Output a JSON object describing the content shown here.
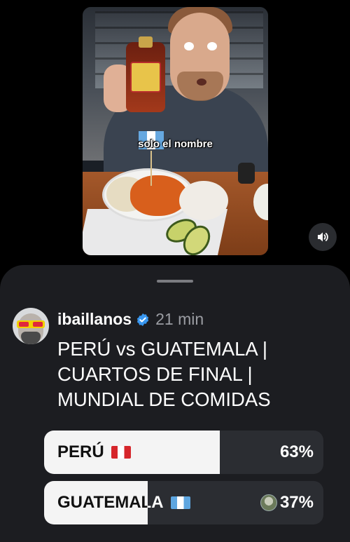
{
  "video": {
    "caption": "solo el nombre",
    "sound_icon": "speaker-icon"
  },
  "post": {
    "username": "ibaillanos",
    "verified_icon": "verified-badge-icon",
    "time": "21 min",
    "title_lines": [
      "PERÚ vs GUATEMALA |",
      "CUARTOS DE FINAL |",
      "MUNDIAL DE COMIDAS"
    ]
  },
  "poll": {
    "options": [
      {
        "label": "PERÚ",
        "flag": "peru-flag-icon",
        "percent_text": "63%",
        "percent": 63
      },
      {
        "label": "GUATEMALA",
        "flag": "guatemala-flag-icon",
        "percent_text": "37%",
        "percent": 37
      }
    ]
  },
  "colors": {
    "background": "#000000",
    "sheet": "#1c1d21",
    "poll_track": "#2b2d32",
    "poll_fill": "#f4f4f4",
    "verified": "#3897f0",
    "muted_text": "#9a9ca2"
  }
}
